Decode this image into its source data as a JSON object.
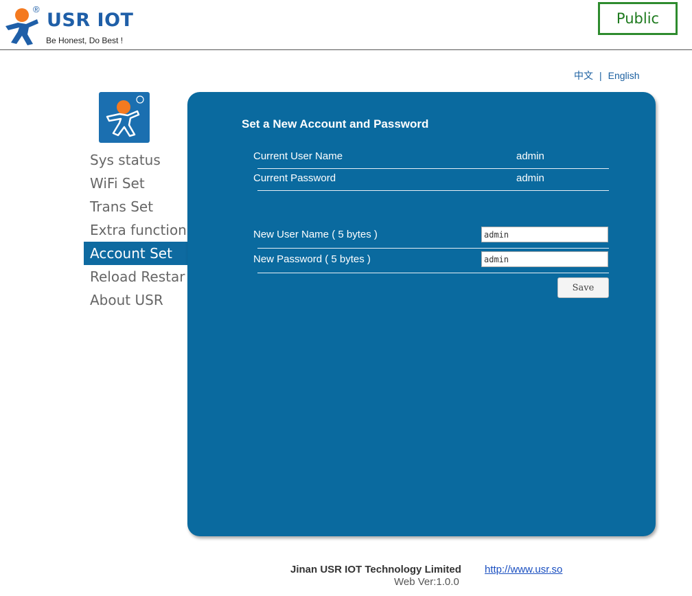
{
  "header": {
    "brand": "USR IOT",
    "tagline": "Be Honest, Do Best !",
    "registered": "®",
    "badge": "Public"
  },
  "language": {
    "chinese": "中文",
    "separator": "|",
    "english": "English"
  },
  "sidebar": {
    "items": [
      {
        "label": "Sys status"
      },
      {
        "label": "WiFi Set"
      },
      {
        "label": "Trans Set"
      },
      {
        "label": "Extra function"
      },
      {
        "label": "Account Set",
        "active": true
      },
      {
        "label": "Reload Restar"
      },
      {
        "label": "About USR"
      }
    ]
  },
  "panel": {
    "title": "Set a New Account and Password",
    "current_user_label": "Current User Name",
    "current_user_value": "admin",
    "current_password_label": "Current Password",
    "current_password_value": "admin",
    "new_user_label": "New User Name ( 5 bytes )",
    "new_user_value": "admin",
    "new_password_label": "New Password ( 5 bytes )",
    "new_password_value": "admin",
    "save_label": "Save"
  },
  "footer": {
    "company": "Jinan USR IOT Technology Limited",
    "link": "http://www.usr.so",
    "version": "Web Ver:1.0.0"
  },
  "colors": {
    "panel": "#0a6a9f",
    "active_nav": "#0e6aa0",
    "brand": "#1f5fa8",
    "badge_border": "#2e8b2e",
    "logo_orange": "#f47a20"
  }
}
